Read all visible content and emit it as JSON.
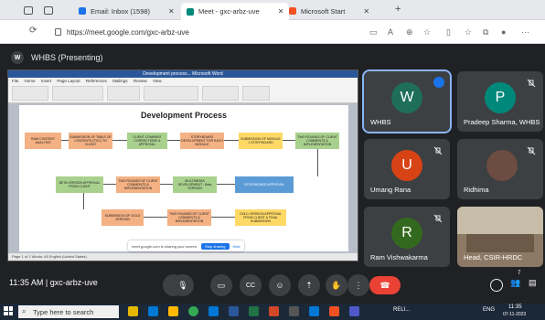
{
  "browser": {
    "tabs": [
      {
        "label": "Email: Inbox (1598)",
        "favicon_color": "#1a73e8"
      },
      {
        "label": "Meet - gxc-arbz-uve",
        "favicon_color": "#00897b"
      },
      {
        "label": "Microsoft Start",
        "favicon_color": "#f25022"
      }
    ],
    "new_tab": "+",
    "url": "https://meet.google.com/gxc-arbz-uve"
  },
  "meet": {
    "presenting_label": "WHBS (Presenting)",
    "presenter_initial": "W",
    "meeting_time": "11:35 AM",
    "meeting_code": "gxc-arbz-uve",
    "participant_count": "7",
    "participants": [
      {
        "name": "WHBS",
        "initial": "W",
        "color": "#1e6e5a"
      },
      {
        "name": "Pradeep Sharma, WHBS",
        "initial": "P",
        "color": "#00897b"
      },
      {
        "name": "Umang Rana",
        "initial": "U",
        "color": "#d84315"
      },
      {
        "name": "Ridhima",
        "initial": "",
        "color": "#6d4c41"
      },
      {
        "name": "Ram Vishwakarma",
        "initial": "R",
        "color": "#33691e"
      },
      {
        "name": "Head, CSIR-HRDC",
        "initial": "",
        "color": "#8d6e63"
      }
    ]
  },
  "shared_doc": {
    "window_title": "Development process... Microsoft Word",
    "ribbon_tabs": [
      "File",
      "Home",
      "Insert",
      "Page Layout",
      "References",
      "Mailings",
      "Review",
      "View"
    ],
    "heading": "Development Process",
    "boxes": {
      "b1": "RAW CONTENT ANALYSIS",
      "b2": "SUBMISSION OF TABLE OF CONTENTS (TOC) TO CLIENT",
      "b3": "CLIENT COMMENT CORRECTIONS & APPROVAL",
      "b4": "STORYBOARD DEVELOPMENT FOR EACH MODULE",
      "b5": "SUBMISSION OF MODULE 1 STORYBOARD",
      "b6": "TWO ROUNDS OF CLIENT COMMENTS & IMPLEMENTATION",
      "b7": "STORYBOARD APPROVAL",
      "b8": "MULTIMEDIA DEVELOPMENT - Beta VERSION",
      "b9": "TWO ROUNDS OF CLIENT COMMENTS & IMPLEMENTATION",
      "b10": "BETA VERSION APPROVAL FROM CLIENT",
      "b11": "SUBMISSION OF GOLD VERSION",
      "b12": "TWO ROUNDS OF CLIENT COMMENTS & IMPLEMENTATION",
      "b13": "GOLD VERSION APPROVAL FROM CLIENT & FINAL SUBMISSION"
    },
    "status_text": "Page 1 of 1   Words: 45   English (United States)",
    "share_notice": "meet.google.com is sharing your screen.",
    "stop_sharing": "Stop sharing",
    "hide": "Hide"
  },
  "windows": {
    "search_placeholder": "Type here to search",
    "tray_time": "11:35",
    "tray_lang": "ENG",
    "tray_date": "07-11-2023",
    "tray_app": "RELI..."
  }
}
